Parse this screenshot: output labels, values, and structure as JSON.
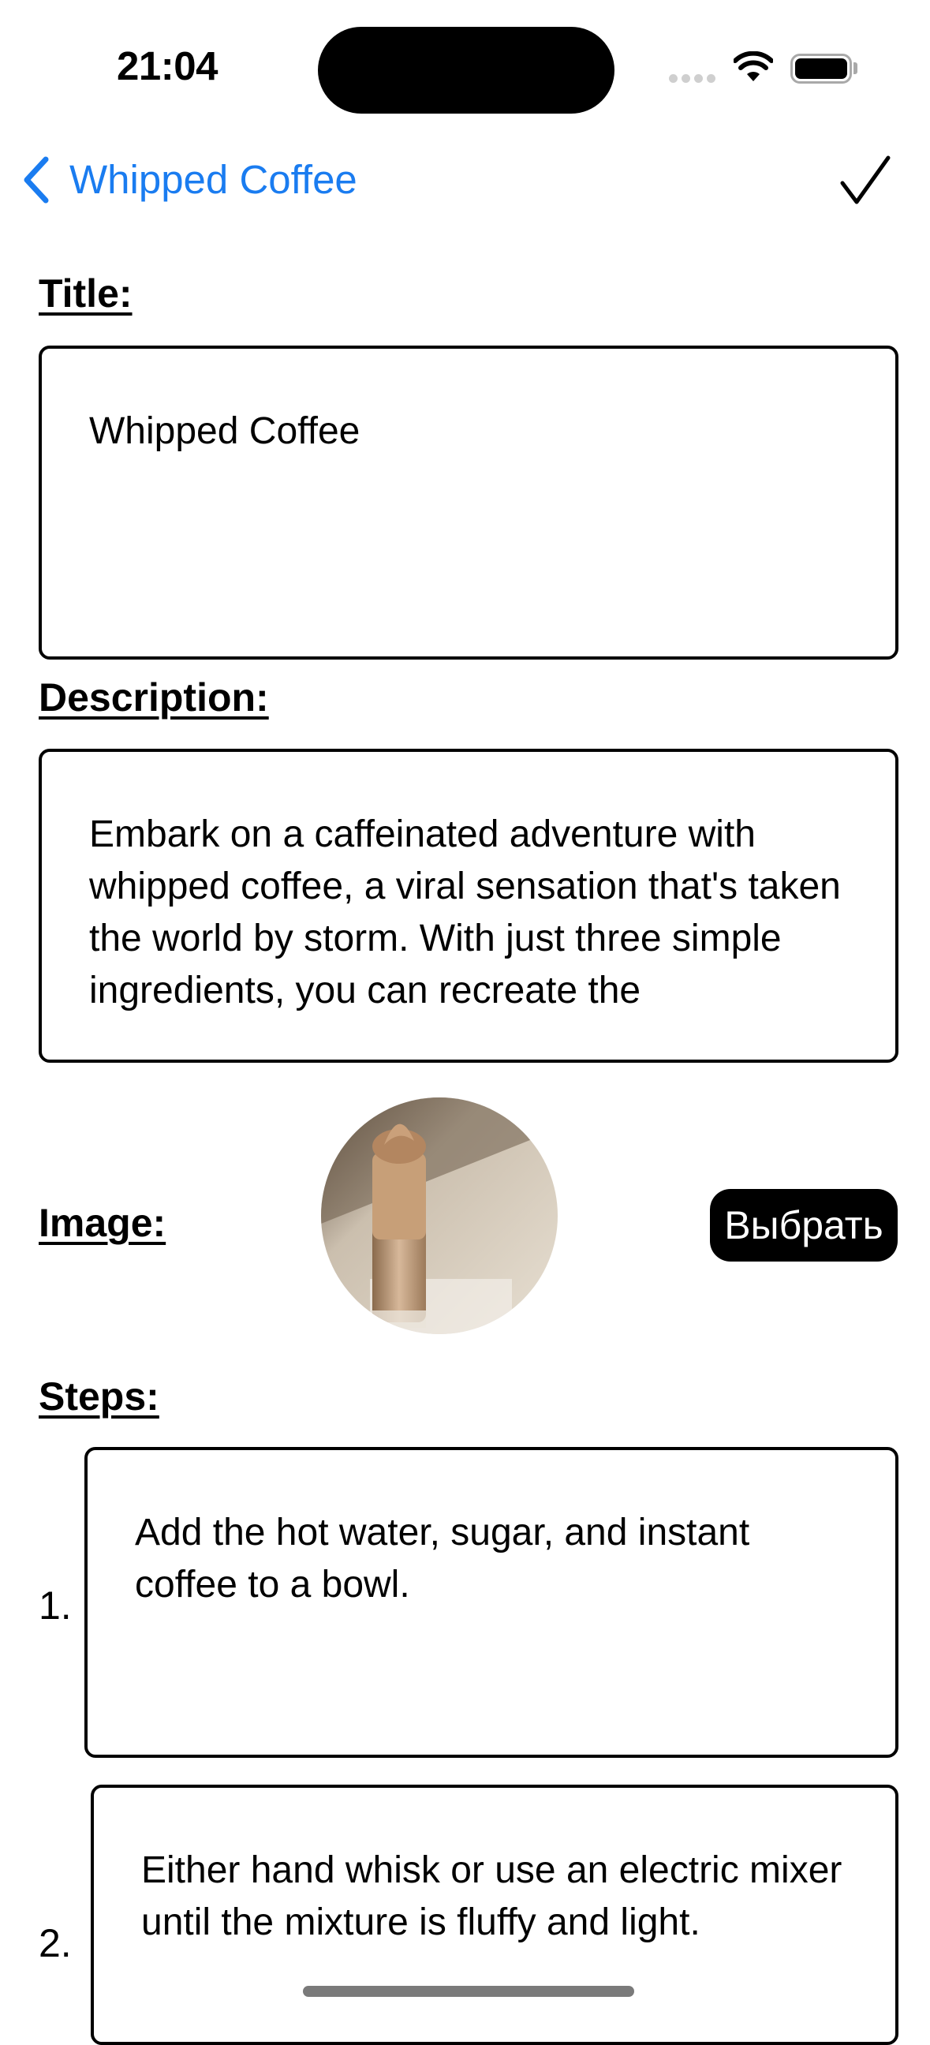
{
  "status_bar": {
    "time": "21:04"
  },
  "nav": {
    "back_label": "Whipped Coffee",
    "back_icon": "chevron-left-icon",
    "done_icon": "checkmark-icon",
    "accent_color": "#1a7cf0"
  },
  "form": {
    "title_label": "Title:",
    "title_value": "Whipped Coffee",
    "description_label": "Description:",
    "description_value": "Embark on a caffeinated adventure with whipped coffee, a viral sensation that's taken the world by storm. With just three simple ingredients, you can recreate the",
    "image_label": "Image:",
    "choose_button_label": "Выбрать",
    "steps_label": "Steps:",
    "steps": [
      {
        "number": "1.",
        "text": "Add the hot water, sugar, and instant coffee to a bowl."
      },
      {
        "number": "2.",
        "text": "Either hand whisk or use an electric mixer until the mixture is fluffy and light."
      }
    ]
  }
}
